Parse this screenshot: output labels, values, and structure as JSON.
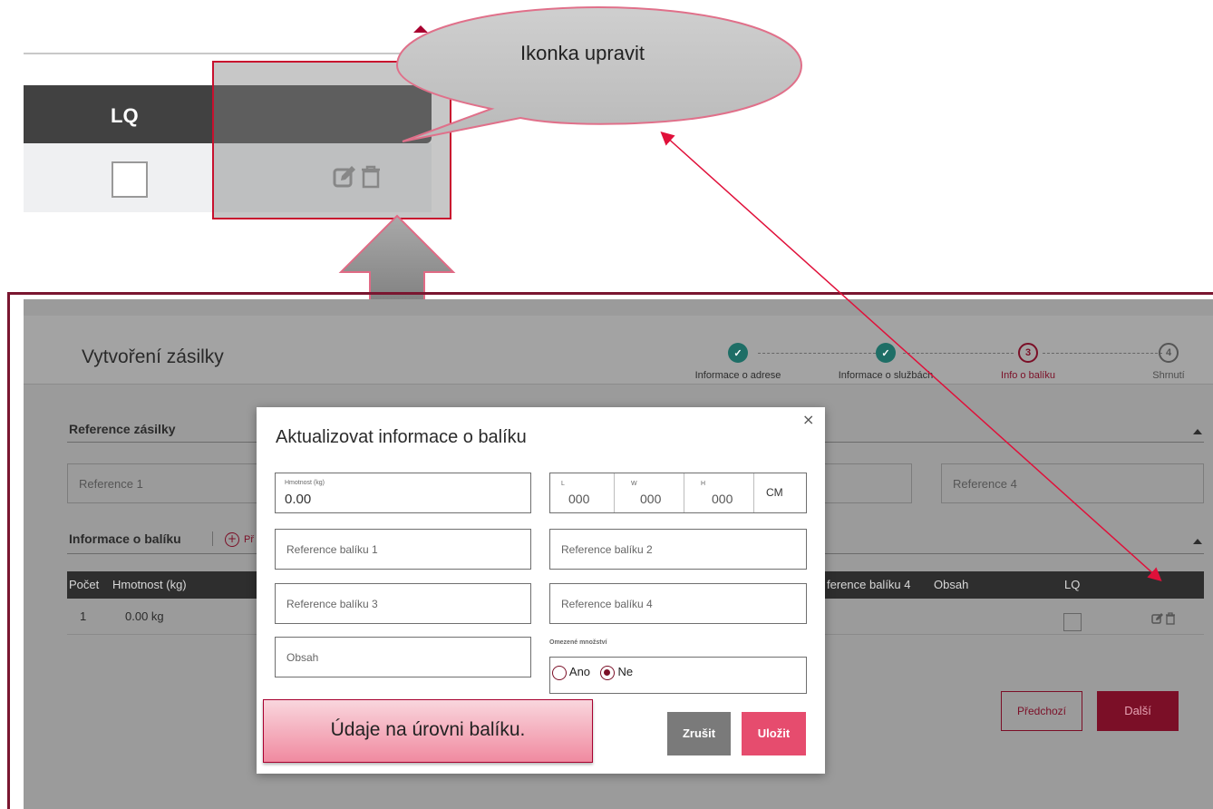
{
  "callout": {
    "bubble_text": "Ikonka upravit",
    "lq_header": "LQ",
    "icons": [
      "edit-icon",
      "trash-icon"
    ]
  },
  "app": {
    "title": "Vytvoření zásilky",
    "steps": [
      {
        "number": "",
        "label": "Informace o adrese",
        "state": "done"
      },
      {
        "number": "",
        "label": "Informace o službách",
        "state": "done"
      },
      {
        "number": "3",
        "label": "Info o balíku",
        "state": "active"
      },
      {
        "number": "4",
        "label": "Shrnutí",
        "state": "todo"
      }
    ],
    "shipment_reference": {
      "label": "Reference zásilky",
      "ref1_placeholder": "Reference 1",
      "ref4_placeholder": "Reference 4"
    },
    "package_info": {
      "label": "Informace o balíku",
      "add_label": "Př"
    },
    "table": {
      "headers": [
        "Počet",
        "Hmotnost (kg)",
        "ference balíku 4",
        "Obsah",
        "LQ"
      ],
      "row": {
        "count": "1",
        "weight": "0.00 kg"
      }
    },
    "buttons": {
      "previous": "Předchozí",
      "next": "Další"
    }
  },
  "modal": {
    "title": "Aktualizovat informace o balíku",
    "close_label": "×",
    "weight_label": "Hmotnost (kg)",
    "weight_value": "0.00",
    "dims": [
      {
        "label": "L",
        "value": "000"
      },
      {
        "label": "W",
        "value": "000"
      },
      {
        "label": "H",
        "value": "000"
      }
    ],
    "unit": "CM",
    "ref1": "Reference balíku 1",
    "ref2": "Reference balíku 2",
    "ref3": "Reference balíku 3",
    "ref4": "Reference balíku 4",
    "content": "Obsah",
    "limited_qty_label": "Omezené množství",
    "option_yes": "Ano",
    "option_no": "Ne",
    "selected_option": "Ne",
    "cancel": "Zrušit",
    "save": "Uložit"
  },
  "note": "Údaje na úrovni balíku.",
  "colors": {
    "brand": "#7b0f27",
    "save": "#e64c6e",
    "done": "#1e6e66",
    "highlight_border": "#c8102e"
  }
}
